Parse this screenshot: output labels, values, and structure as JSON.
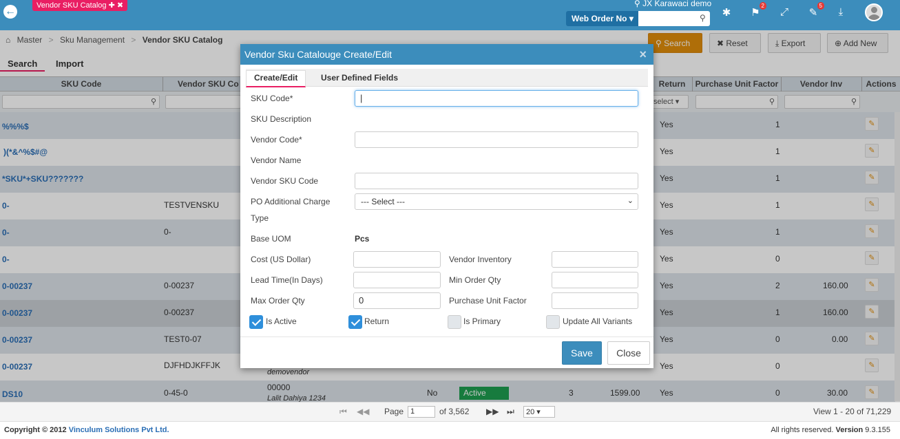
{
  "header": {
    "app_tab": "Vendor SKU Catalog ✚ ✖",
    "location": "JX Karawaci demo",
    "web_order_label": "Web Order No",
    "web_order_caret": "▾",
    "badges": {
      "flag": "2",
      "tools": "5"
    }
  },
  "breadcrumb": [
    "Master",
    "Sku Management",
    "Vendor SKU Catalog"
  ],
  "toolbar": {
    "search": "Search",
    "reset": "Reset",
    "export": "Export",
    "add_new": "Add New"
  },
  "page_tabs": [
    "Search",
    "Import"
  ],
  "grid": {
    "columns": [
      "SKU Code",
      "Vendor SKU Co",
      "Return",
      "Purchase Unit Factor",
      "Vendor Inv",
      "Actions"
    ],
    "return_filter": "select",
    "rows": [
      {
        "sku": "%%%$",
        "vsku": "",
        "vendor": "",
        "vendor_sub": "",
        "ret": "Yes",
        "puf": "1",
        "vinv": ""
      },
      {
        "sku": ")(*&^%$#@",
        "vsku": "",
        "vendor": "",
        "vendor_sub": "",
        "ret": "Yes",
        "puf": "1",
        "vinv": ""
      },
      {
        "sku": "*SKU*+SKU???????",
        "vsku": "",
        "vendor": "",
        "vendor_sub": "",
        "ret": "Yes",
        "puf": "1",
        "vinv": ""
      },
      {
        "sku": "0-",
        "vsku": "TESTVENSKU",
        "vendor": "",
        "vendor_sub": "",
        "ret": "Yes",
        "puf": "1",
        "vinv": ""
      },
      {
        "sku": "0-",
        "vsku": "0-",
        "vendor": "",
        "vendor_sub": "",
        "ret": "Yes",
        "puf": "1",
        "vinv": ""
      },
      {
        "sku": "0-",
        "vsku": "",
        "vendor": "",
        "vendor_sub": "",
        "ret": "Yes",
        "puf": "0",
        "vinv": ""
      },
      {
        "sku": "0-00237",
        "vsku": "0-00237",
        "vendor": "",
        "vendor_sub": "",
        "ret": "Yes",
        "puf": "2",
        "vinv": "160.00"
      },
      {
        "sku": "0-00237",
        "vsku": "0-00237",
        "vendor": "",
        "vendor_sub": "",
        "ret": "Yes",
        "puf": "1",
        "vinv": "160.00"
      },
      {
        "sku": "0-00237",
        "vsku": "TEST0-07",
        "vendor": "",
        "vendor_sub": "",
        "ret": "Yes",
        "puf": "0",
        "vinv": "0.00"
      },
      {
        "sku": "0-00237",
        "vsku": "DJFHDJKFFJK",
        "vendor": "",
        "vendor_sub": "demovendor",
        "ret": "Yes",
        "puf": "0",
        "vinv": ""
      },
      {
        "sku": "DS10",
        "vsku": "0-45-0",
        "vendor": "00000",
        "vendor_sub": "Lalit Dahiya 1234",
        "no": "No",
        "status": "Active",
        "n3": "3",
        "price": "1599.00",
        "ret": "Yes",
        "puf": "0",
        "vinv": "30.00"
      }
    ]
  },
  "pager": {
    "page_label": "Page",
    "page": "1",
    "of": "of 3,562",
    "per_page": "20",
    "view": "View 1 - 20 of 71,229"
  },
  "footer": {
    "copyright": "Copyright © 2012",
    "company": "Vinculum Solutions Pvt Ltd.",
    "rights": "All rights reserved.",
    "version_label": "Version",
    "version": "9.3.155"
  },
  "modal": {
    "title": "Vendor Sku Catalouge Create/Edit",
    "tabs": [
      "Create/Edit",
      "User Defined Fields"
    ],
    "labels": {
      "sku_code": "SKU Code*",
      "sku_desc": "SKU Description",
      "vendor_code": "Vendor Code*",
      "vendor_name": "Vendor Name",
      "vendor_sku": "Vendor SKU Code",
      "po_charge_1": "PO Additional Charge",
      "po_charge_2": "Type",
      "base_uom": "Base UOM",
      "cost": "Cost (US Dollar)",
      "vendor_inventory": "Vendor Inventory",
      "lead_time": "Lead Time(In Days)",
      "min_order": "Min Order Qty",
      "max_order": "Max Order Qty",
      "puf": "Purchase Unit Factor"
    },
    "values": {
      "base_uom": "Pcs",
      "po_select": "--- Select ---",
      "max_order": "0"
    },
    "checkboxes": {
      "is_active": "Is Active",
      "return": "Return",
      "is_primary": "Is Primary",
      "update_all": "Update All Variants"
    },
    "save": "Save",
    "close": "Close"
  }
}
